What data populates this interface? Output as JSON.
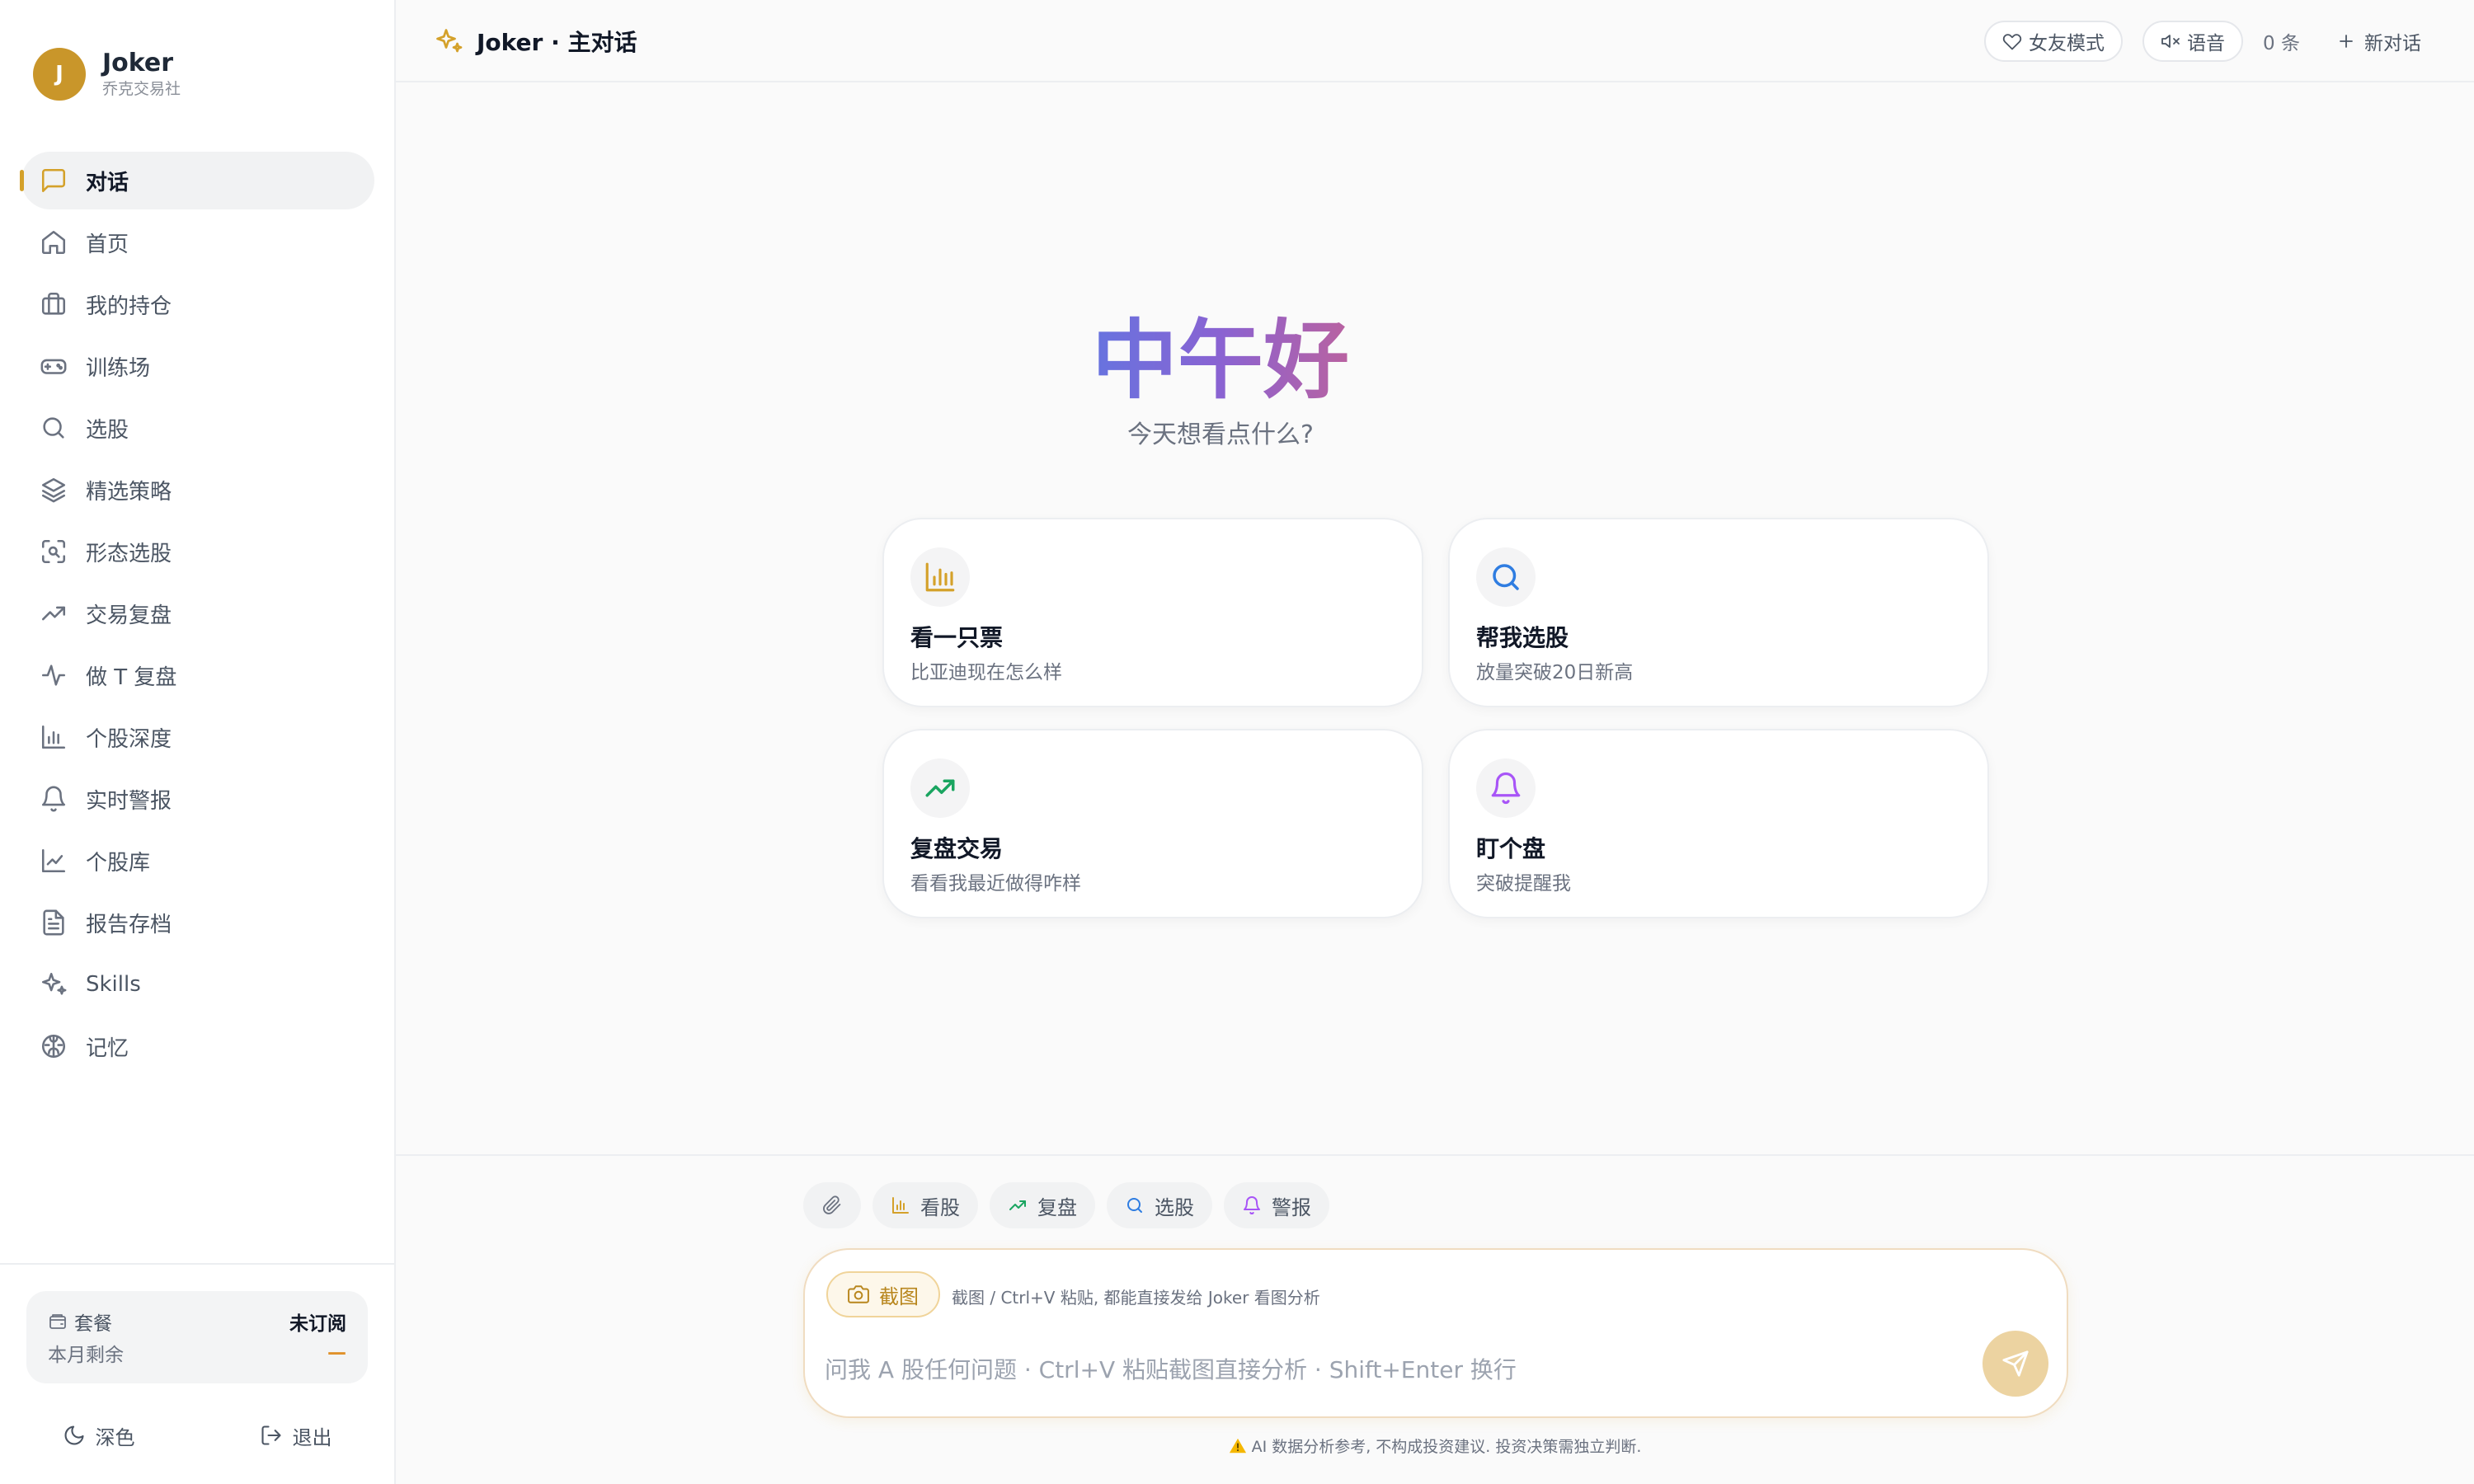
{
  "app": {
    "avatar_letter": "J",
    "name": "Joker",
    "subtitle": "乔克交易社"
  },
  "sidebar": {
    "items": [
      {
        "label": "对话",
        "icon": "chat-icon",
        "active": true
      },
      {
        "label": "首页",
        "icon": "home-icon"
      },
      {
        "label": "我的持仓",
        "icon": "briefcase-icon"
      },
      {
        "label": "训练场",
        "icon": "gamepad-icon"
      },
      {
        "label": "选股",
        "icon": "search-icon"
      },
      {
        "label": "精选策略",
        "icon": "layers-icon"
      },
      {
        "label": "形态选股",
        "icon": "scan-icon"
      },
      {
        "label": "交易复盘",
        "icon": "trending-up-icon"
      },
      {
        "label": "做 T 复盘",
        "icon": "activity-icon"
      },
      {
        "label": "个股深度",
        "icon": "bar-chart-icon"
      },
      {
        "label": "实时警报",
        "icon": "bell-icon"
      },
      {
        "label": "个股库",
        "icon": "line-chart-icon"
      },
      {
        "label": "报告存档",
        "icon": "file-text-icon"
      },
      {
        "label": "Skills",
        "icon": "sparkles-icon"
      },
      {
        "label": "记忆",
        "icon": "brain-icon"
      }
    ]
  },
  "plan": {
    "label": "套餐",
    "status": "未订阅",
    "remaining_label": "本月剩余",
    "remaining_value": "—"
  },
  "footer": {
    "theme_label": "深色",
    "logout_label": "退出"
  },
  "topbar": {
    "title": "Joker · 主对话",
    "girlfriend_mode_label": "女友模式",
    "voice_label": "语音",
    "count": "0 条",
    "new_chat_label": "新对话"
  },
  "hero": {
    "greeting": "中午好",
    "subtitle": "今天想看点什么?"
  },
  "cards": [
    {
      "title": "看一只票",
      "subtitle": "比亚迪现在怎么样",
      "icon": "bar-chart-icon",
      "color": "#d4a12a"
    },
    {
      "title": "帮我选股",
      "subtitle": "放量突破20日新高",
      "icon": "search-icon",
      "color": "#2f7de1"
    },
    {
      "title": "复盘交易",
      "subtitle": "看看我最近做得咋样",
      "icon": "trending-up-icon",
      "color": "#1aa560"
    },
    {
      "title": "盯个盘",
      "subtitle": "突破提醒我",
      "icon": "bell-icon",
      "color": "#a855f7"
    }
  ],
  "quick_actions": [
    {
      "label": "看股",
      "icon": "bar-chart-icon",
      "color": "#d4a12a"
    },
    {
      "label": "复盘",
      "icon": "trending-up-icon",
      "color": "#1aa560"
    },
    {
      "label": "选股",
      "icon": "search-icon",
      "color": "#2f7de1"
    },
    {
      "label": "警报",
      "icon": "bell-icon",
      "color": "#a855f7"
    }
  ],
  "composer": {
    "screenshot_label": "截图",
    "screenshot_hint": "截图 / Ctrl+V 粘贴, 都能直接发给 Joker 看图分析",
    "placeholder": "问我 A 股任何问题 · Ctrl+V 粘贴截图直接分析 · Shift+Enter 换行",
    "value": ""
  },
  "disclaimer": "AI 数据分析参考, 不构成投资建议. 投资决策需独立判断.",
  "colors": {
    "accent": "#d4a12a",
    "avatar": "#c9962a",
    "send_button": "#ecd3a1"
  }
}
